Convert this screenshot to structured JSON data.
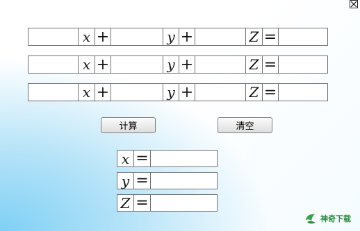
{
  "window": {
    "close_icon": "close-x-icon"
  },
  "equations": [
    {
      "a_value": "",
      "x_symbol": "x",
      "plus1": "+",
      "b_value": "",
      "y_symbol": "y",
      "plus2": "+",
      "c_value": "",
      "z_symbol": "Z",
      "equals": "=",
      "d_value": ""
    },
    {
      "a_value": "",
      "x_symbol": "x",
      "plus1": "+",
      "b_value": "",
      "y_symbol": "y",
      "plus2": "+",
      "c_value": "",
      "z_symbol": "Z",
      "equals": "=",
      "d_value": ""
    },
    {
      "a_value": "",
      "x_symbol": "x",
      "plus1": "+",
      "b_value": "",
      "y_symbol": "y",
      "plus2": "+",
      "c_value": "",
      "z_symbol": "Z",
      "equals": "=",
      "d_value": ""
    }
  ],
  "buttons": {
    "calculate_label": "计算",
    "clear_label": "清空"
  },
  "results": [
    {
      "symbol": "x",
      "equals": "=",
      "value": ""
    },
    {
      "symbol": "y",
      "equals": "=",
      "value": ""
    },
    {
      "symbol": "Z",
      "equals": "=",
      "value": ""
    }
  ],
  "watermark": {
    "text": "神奇下载",
    "color": "#2e8b3e"
  }
}
